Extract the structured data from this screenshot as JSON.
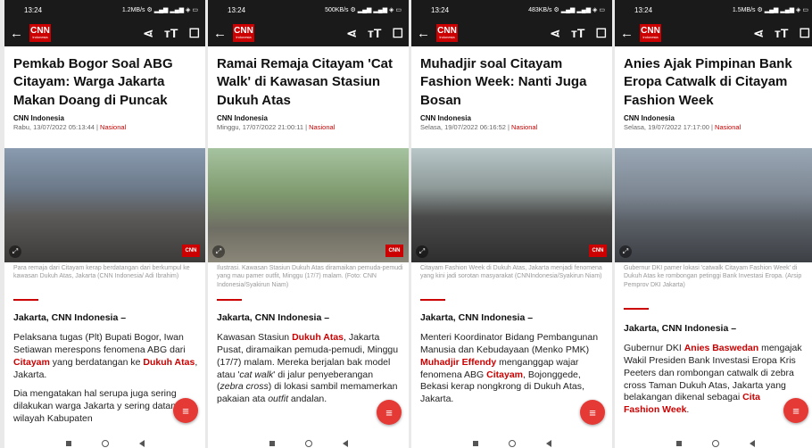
{
  "phones": [
    {
      "status": {
        "time": "13:24",
        "right": "1.2MB/s ⚙ ▂▄▆ ▂▄▆ ◈ ▭"
      },
      "title": "Pemkab Bogor Soal ABG Citayam: Warga Jakarta Makan Doang di Puncak",
      "source": "CNN Indonesia",
      "date": "Rabu, 13/07/2022 05:13:44 | ",
      "category": "Nasional",
      "caption": "Para remaja dari Citayam kerap berdatangan dari berkumpul ke kawasan Dukuh Atas, Jakarta (CNN Indonesia/ Adi Ibrahim)",
      "lead": "Jakarta, CNN Indonesia –",
      "p1": [
        "Pelaksana tugas (Plt) Bupati Bogor, Iwan Setiawan merespons fenomena ABG dari ",
        "Citayam",
        " yang berdatangan ke ",
        "Dukuh Atas",
        ", Jakarta."
      ],
      "p2": "Dia mengatakan hal serupa juga sering dilakukan warga Jakarta y sering datang ke wilayah Kabupaten"
    },
    {
      "status": {
        "time": "13:24",
        "right": "500KB/s ⚙ ▂▄▆ ▂▄▆ ◈ ▭"
      },
      "title": "Ramai Remaja Citayam 'Cat Walk' di Kawasan Stasiun Dukuh Atas",
      "source": "CNN Indonesia",
      "date": "Minggu, 17/07/2022 21:00:11 | ",
      "category": "Nasional",
      "caption": "Ilustrasi. Kawasan Stasiun Dukuh Atas diramaikan pemuda-pemudi yang mau pamer outfit, Minggu (17/7) malam. (Foto: CNN Indonesia/Syakirun Niam)",
      "lead": "Jakarta, CNN Indonesia –",
      "p1": [
        "Kawasan Stasiun ",
        "Dukuh Atas",
        ", Jakarta Pusat, diramaikan pemuda-pemudi, Minggu (17/7) malam. Mereka berjalan bak model atau '",
        "cat walk",
        "' di jalur penyeberangan (",
        "zebra cross",
        ") di lokasi sambil memamerkan pakaian ata ",
        "outfit",
        " andalan."
      ]
    },
    {
      "status": {
        "time": "13:24",
        "right": "483KB/s ⚙ ▂▄▆ ▂▄▆ ◈ ▭"
      },
      "title": "Muhadjir soal Citayam Fashion Week: Nanti Juga Bosan",
      "source": "CNN Indonesia",
      "date": "Selasa, 19/07/2022 06:16:52 | ",
      "category": "Nasional",
      "caption": "Citayam Fashion Week di Dukuh Atas, Jakarta menjadi fenomena yang kini jadi sorotan masyarakat (CNNIndonesia/Syakirun Niam)",
      "lead": "Jakarta, CNN Indonesia –",
      "p1": [
        "Menteri Koordinator Bidang Pembangunan Manusia dan Kebudayaan (Menko PMK) ",
        "Muhadjir Effendy",
        " menganggap wajar fenomena ABG ",
        "Citayam",
        ", Bojonggede, Bekasi kerap nongkrong di Dukuh Atas, Jakarta."
      ]
    },
    {
      "status": {
        "time": "13:24",
        "right": "1.5MB/s ⚙ ▂▄▆ ▂▄▆ ◈ ▭"
      },
      "title": "Anies Ajak Pimpinan Bank Eropa Catwalk di Citayam Fashion Week",
      "source": "CNN Indonesia",
      "date": "Selasa, 19/07/2022 17:17:00 | ",
      "category": "Nasional",
      "caption": "Gubernur DKI pamer lokasi 'catwalk Citayam Fashion Week' di Dukuh Atas ke rombongan petinggi Bank Investasi Eropa. (Arsip Pemprov DKI Jakarta)",
      "lead": "Jakarta, CNN Indonesia –",
      "p1": [
        "Gubernur DKI ",
        "Anies Baswedan",
        " mengajak Wakil Presiden Bank Investasi Eropa Kris Peeters dan rombongan catwalk di zebra cross Taman Dukuh Atas, Jakarta yang belakangan dikenal sebagai ",
        "Cita",
        "",
        "Fashion Week",
        "."
      ]
    }
  ],
  "logo": {
    "main": "CNN",
    "sub": "Indonesia"
  },
  "watermark": "CNN",
  "icons": {
    "back": "←",
    "share": "⋖",
    "textsize": "ᴛT",
    "bookmark": "☐",
    "fab": "≡",
    "expand": "⤢"
  },
  "colors": {
    "accent": "#cc0000",
    "fab": "#e53935",
    "bar": "#1a1a1a"
  }
}
